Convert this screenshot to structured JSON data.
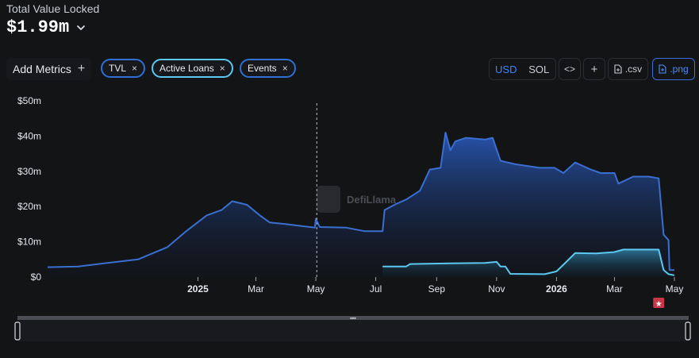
{
  "header": {
    "label": "Total Value Locked",
    "value": "$1.99m"
  },
  "toolbar": {
    "add_metrics": "Add Metrics",
    "add_icon": "+",
    "pills": [
      {
        "label": "TVL",
        "close": "×"
      },
      {
        "label": "Active Loans",
        "close": "×"
      },
      {
        "label": "Events",
        "close": "×"
      }
    ],
    "currency": {
      "usd": "USD",
      "sol": "SOL"
    },
    "embed_icon": "<>",
    "plus_icon": "+",
    "csv": ".csv",
    "png": ".png"
  },
  "watermark": "DefiLlama",
  "colors": {
    "tvl": "#3a6fd1",
    "loans": "#5cc8f2",
    "event_marker": "#c93647",
    "background": "#131416"
  },
  "chart_data": {
    "type": "area",
    "x_axis": "date",
    "xlim": [
      "2024-08-01",
      "2026-05-01"
    ],
    "ylim": [
      0,
      50000000
    ],
    "yticks": [
      "$0",
      "$10m",
      "$20m",
      "$30m",
      "$40m",
      "$50m"
    ],
    "ytick_values": [
      0,
      10000000,
      20000000,
      30000000,
      40000000,
      50000000
    ],
    "xticks": [
      {
        "date": "2025-01-01",
        "label": "2025",
        "bold": true
      },
      {
        "date": "2025-03-01",
        "label": "Mar",
        "bold": false
      },
      {
        "date": "2025-05-01",
        "label": "May",
        "bold": false
      },
      {
        "date": "2025-07-01",
        "label": "Jul",
        "bold": false
      },
      {
        "date": "2025-09-01",
        "label": "Sep",
        "bold": false
      },
      {
        "date": "2025-11-01",
        "label": "Nov",
        "bold": false
      },
      {
        "date": "2026-01-01",
        "label": "2026",
        "bold": true
      },
      {
        "date": "2026-03-01",
        "label": "Mar",
        "bold": false
      },
      {
        "date": "2026-05-01",
        "label": "May",
        "bold": false
      }
    ],
    "event_line_date": "2025-05-02",
    "event_marker_date": "2026-04-15",
    "series": [
      {
        "name": "TVL",
        "points": [
          [
            "2024-08-01",
            2800000
          ],
          [
            "2024-09-01",
            3000000
          ],
          [
            "2024-10-01",
            4000000
          ],
          [
            "2024-11-01",
            5000000
          ],
          [
            "2024-12-01",
            8500000
          ],
          [
            "2024-12-20",
            13000000
          ],
          [
            "2025-01-10",
            17500000
          ],
          [
            "2025-01-25",
            19000000
          ],
          [
            "2025-02-05",
            21500000
          ],
          [
            "2025-02-20",
            20500000
          ],
          [
            "2025-03-05",
            17500000
          ],
          [
            "2025-03-15",
            15500000
          ],
          [
            "2025-04-01",
            15000000
          ],
          [
            "2025-04-30",
            14000000
          ],
          [
            "2025-05-01",
            16500000
          ],
          [
            "2025-05-05",
            14200000
          ],
          [
            "2025-06-01",
            14000000
          ],
          [
            "2025-06-20",
            13000000
          ],
          [
            "2025-07-08",
            13000000
          ],
          [
            "2025-07-10",
            19000000
          ],
          [
            "2025-07-20",
            20500000
          ],
          [
            "2025-08-01",
            22000000
          ],
          [
            "2025-08-15",
            24500000
          ],
          [
            "2025-08-25",
            30500000
          ],
          [
            "2025-09-05",
            31000000
          ],
          [
            "2025-09-10",
            41000000
          ],
          [
            "2025-09-15",
            36000000
          ],
          [
            "2025-09-20",
            38500000
          ],
          [
            "2025-10-01",
            39500000
          ],
          [
            "2025-10-20",
            39000000
          ],
          [
            "2025-10-28",
            39500000
          ],
          [
            "2025-11-05",
            33000000
          ],
          [
            "2025-11-20",
            32000000
          ],
          [
            "2025-12-15",
            31000000
          ],
          [
            "2025-12-30",
            31000000
          ],
          [
            "2026-01-08",
            29500000
          ],
          [
            "2026-01-20",
            32500000
          ],
          [
            "2026-02-05",
            30500000
          ],
          [
            "2026-02-15",
            29500000
          ],
          [
            "2026-03-01",
            29500000
          ],
          [
            "2026-03-05",
            26500000
          ],
          [
            "2026-03-20",
            28500000
          ],
          [
            "2026-04-05",
            28500000
          ],
          [
            "2026-04-15",
            28000000
          ],
          [
            "2026-04-20",
            12000000
          ],
          [
            "2026-04-25",
            10500000
          ],
          [
            "2026-04-26",
            2000000
          ],
          [
            "2026-05-01",
            1990000
          ]
        ]
      },
      {
        "name": "Active Loans",
        "points": [
          [
            "2025-07-08",
            3000000
          ],
          [
            "2025-08-01",
            3000000
          ],
          [
            "2025-08-05",
            3700000
          ],
          [
            "2025-09-15",
            3900000
          ],
          [
            "2025-10-20",
            4000000
          ],
          [
            "2025-11-01",
            4300000
          ],
          [
            "2025-11-05",
            3000000
          ],
          [
            "2025-11-10",
            3000000
          ],
          [
            "2025-11-15",
            900000
          ],
          [
            "2025-12-20",
            800000
          ],
          [
            "2026-01-01",
            1600000
          ],
          [
            "2026-01-08",
            3500000
          ],
          [
            "2026-01-20",
            6800000
          ],
          [
            "2026-02-10",
            6700000
          ],
          [
            "2026-03-01",
            7100000
          ],
          [
            "2026-03-10",
            7800000
          ],
          [
            "2026-04-15",
            7800000
          ],
          [
            "2026-04-20",
            2000000
          ],
          [
            "2026-04-25",
            800000
          ],
          [
            "2026-05-01",
            500000
          ]
        ]
      }
    ]
  }
}
